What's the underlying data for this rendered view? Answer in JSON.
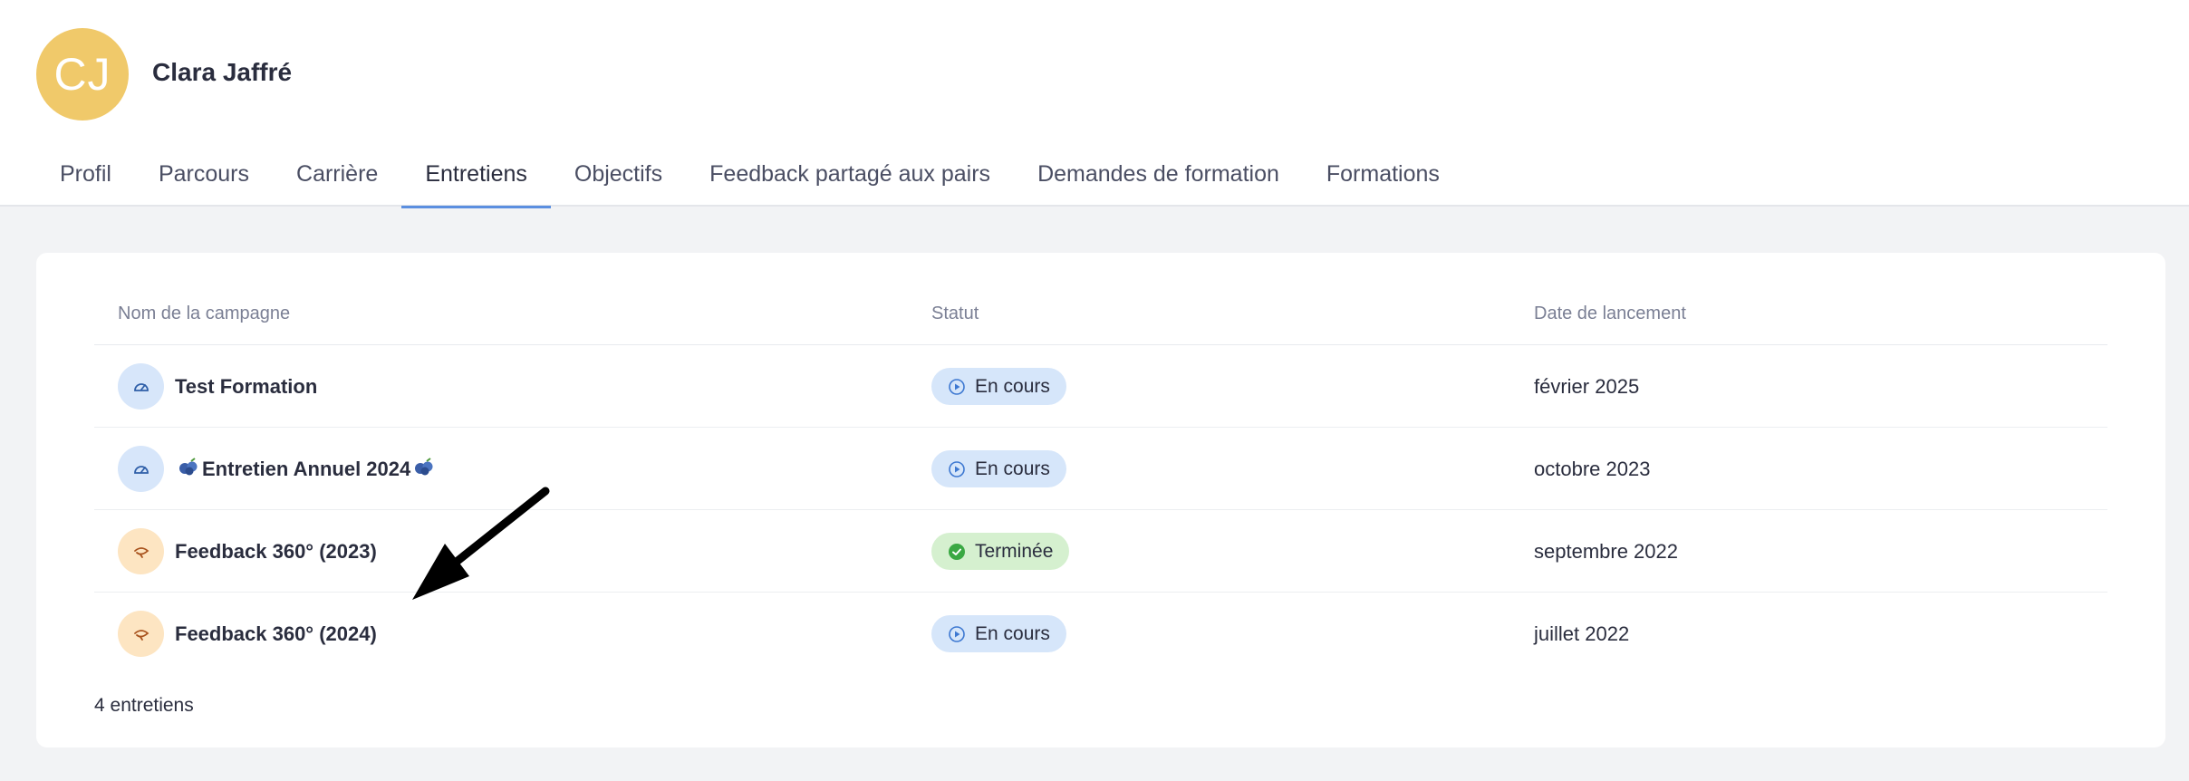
{
  "user": {
    "initials": "CJ",
    "name": "Clara Jaffré"
  },
  "tabs": [
    {
      "label": "Profil",
      "active": false
    },
    {
      "label": "Parcours",
      "active": false
    },
    {
      "label": "Carrière",
      "active": false
    },
    {
      "label": "Entretiens",
      "active": true
    },
    {
      "label": "Objectifs",
      "active": false
    },
    {
      "label": "Feedback partagé aux pairs",
      "active": false
    },
    {
      "label": "Demandes de formation",
      "active": false
    },
    {
      "label": "Formations",
      "active": false
    }
  ],
  "table": {
    "headers": {
      "name": "Nom de la campagne",
      "status": "Statut",
      "date": "Date de lancement"
    },
    "rows": [
      {
        "icon": "gauge-icon",
        "name": "Test Formation",
        "status": "En cours",
        "date": "février 2025"
      },
      {
        "icon": "gauge-icon",
        "name": "Entretien Annuel 2024",
        "status": "En cours",
        "date": "octobre 2023"
      },
      {
        "icon": "feedback-loop-icon",
        "name": "Feedback 360° (2023)",
        "status": "Terminée",
        "date": "septembre 2022"
      },
      {
        "icon": "feedback-loop-icon",
        "name": "Feedback 360° (2024)",
        "status": "En cours",
        "date": "juillet 2022"
      }
    ]
  },
  "footer": {
    "count": "4 entretiens"
  },
  "colors": {
    "accent": "#5b8fe0",
    "avatar": "#f0c96a",
    "badge_ongoing": "#d6e6fa",
    "badge_done": "#d5f0cf"
  }
}
